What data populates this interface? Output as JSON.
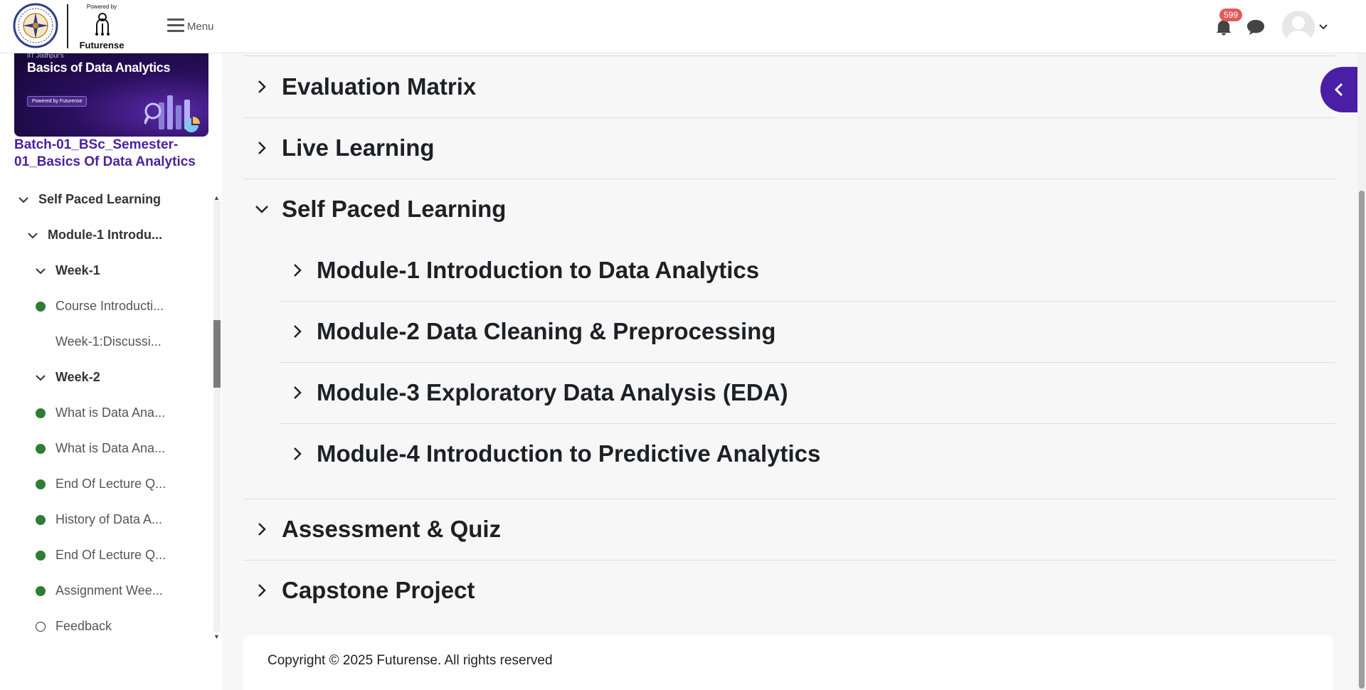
{
  "header": {
    "powered_by": "Powered by",
    "brand": "Futurense",
    "menu_label": "Menu",
    "notification_count": "599"
  },
  "sidebar": {
    "banner_kicker": "IIT Jodhpur's",
    "banner_title": "Basics of Data Analytics",
    "banner_pill": "Powered by Futurense",
    "course_title": "Batch-01_BSc_Semester-01_Basics Of Data Analytics",
    "items": [
      {
        "label": "Self Paced Learning",
        "kind": "section"
      },
      {
        "label": "Module-1 Introdu...",
        "kind": "module"
      },
      {
        "label": "Week-1",
        "kind": "week"
      },
      {
        "label": "Course Introducti...",
        "kind": "done"
      },
      {
        "label": "Week-1:Discussi...",
        "kind": "plain"
      },
      {
        "label": "Week-2",
        "kind": "week"
      },
      {
        "label": "What is Data Ana...",
        "kind": "done"
      },
      {
        "label": "What is Data Ana...",
        "kind": "done"
      },
      {
        "label": "End Of Lecture Q...",
        "kind": "done"
      },
      {
        "label": "History of Data A...",
        "kind": "done"
      },
      {
        "label": "End Of Lecture Q...",
        "kind": "done"
      },
      {
        "label": "Assignment Wee...",
        "kind": "done"
      },
      {
        "label": "Feedback",
        "kind": "todo"
      }
    ]
  },
  "main": {
    "sections": [
      {
        "title": "Evaluation Matrix",
        "expanded": false
      },
      {
        "title": "Live Learning",
        "expanded": false
      },
      {
        "title": "Self Paced Learning",
        "expanded": true
      },
      {
        "title": "Assessment & Quiz",
        "expanded": false
      },
      {
        "title": "Capstone Project",
        "expanded": false
      }
    ],
    "modules": [
      {
        "title": "Module-1 Introduction to Data Analytics"
      },
      {
        "title": "Module-2 Data Cleaning & Preprocessing"
      },
      {
        "title": "Module-3 Exploratory Data Analysis (EDA)"
      },
      {
        "title": "Module-4 Introduction to Predictive Analytics"
      }
    ]
  },
  "footer": {
    "copyright": "Copyright © 2025 Futurense. All rights reserved"
  },
  "colors": {
    "brand_purple": "#4a1fa6",
    "course_title": "#4b1fa0",
    "complete_dot": "#2e7d32",
    "badge": "#e35a5a"
  }
}
